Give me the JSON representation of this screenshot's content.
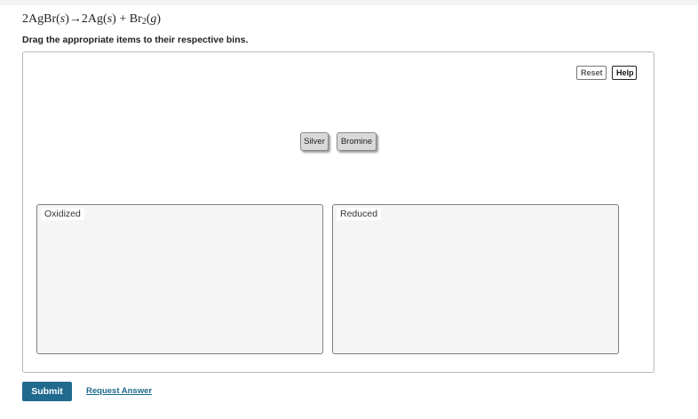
{
  "equation": {
    "reactant_coef": "2",
    "reactant": "AgBr",
    "reactant_state": "s",
    "arrow": "→",
    "product1_coef": "2",
    "product1": "Ag",
    "product1_state": "s",
    "plus": "+",
    "product2": "Br",
    "product2_sub": "2",
    "product2_state": "g"
  },
  "instructions": "Drag the appropriate items to their respective bins.",
  "toolbar": {
    "reset_label": "Reset",
    "help_label": "Help"
  },
  "items": [
    "Silver",
    "Bromine"
  ],
  "bins": {
    "oxidized": "Oxidized",
    "reduced": "Reduced"
  },
  "actions": {
    "submit_label": "Submit",
    "request_answer_label": "Request Answer"
  },
  "colors": {
    "accent": "#1f6a8e",
    "item_bg": "#d9d9d9",
    "bin_bg": "#f5f5f5"
  }
}
